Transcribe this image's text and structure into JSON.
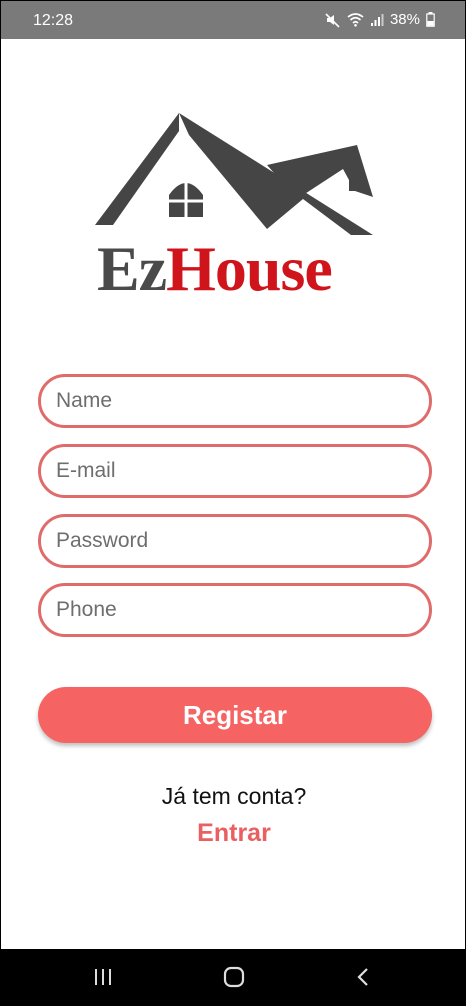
{
  "status_bar": {
    "time": "12:28",
    "battery": "38%",
    "icons": [
      "mute-icon",
      "wifi-icon",
      "signal-icon",
      "battery-icon"
    ]
  },
  "logo": {
    "brand_ez": "Ez",
    "brand_house": "House",
    "colors": {
      "roof": "#454545",
      "ez": "#4a4a4a",
      "house": "#d0141b"
    }
  },
  "form": {
    "name_placeholder": "Name",
    "email_placeholder": "E-mail",
    "password_placeholder": "Password",
    "phone_placeholder": "Phone",
    "border_color": "#e06b6b"
  },
  "register_button": {
    "label": "Registar",
    "color": "#f56363"
  },
  "login_prompt": {
    "question": "Já tem conta?",
    "link": "Entrar",
    "link_color": "#e86060"
  },
  "nav_bar": {
    "icons": [
      "recent-apps-icon",
      "home-icon",
      "back-icon"
    ]
  }
}
